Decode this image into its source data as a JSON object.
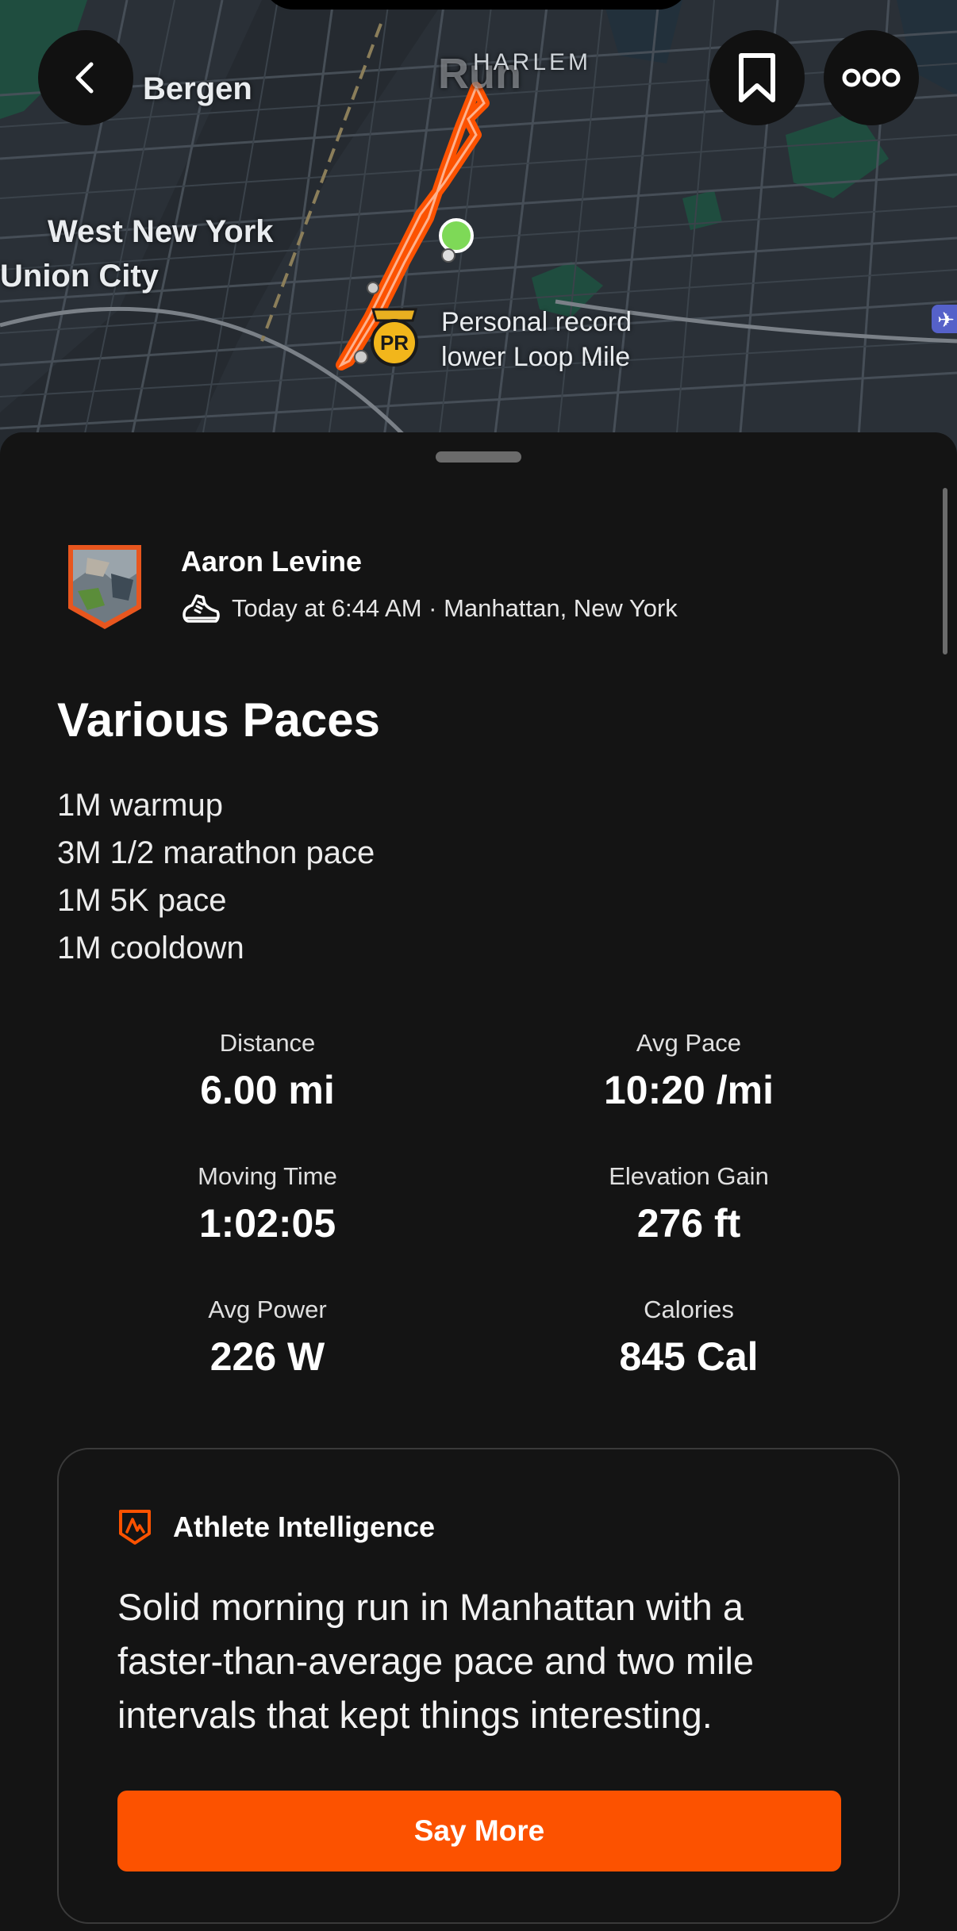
{
  "map": {
    "labels": {
      "bergen": "Bergen",
      "harlem": "HARLEM",
      "run_watermark": "Run",
      "west_new_york": "West New York",
      "union_city": "Union City",
      "pr_line1": "Personal record",
      "pr_line2": "lower Loop Mile",
      "pr_badge": "PR"
    },
    "route_color": "#fc5200",
    "start_marker_color": "#7ed957"
  },
  "nav": {
    "back_icon": "chevron-left-icon",
    "bookmark_icon": "bookmark-icon",
    "more_icon": "more-dots-icon"
  },
  "activity": {
    "athlete_name": "Aaron Levine",
    "meta": "Today at 6:44 AM · Manhattan, New York",
    "sport_icon": "running-shoe-icon",
    "title": "Various Paces",
    "description": [
      "1M warmup",
      "3M 1/2 marathon pace",
      "1M 5K pace",
      "1M cooldown"
    ]
  },
  "stats": [
    {
      "label": "Distance",
      "value": "6.00 mi"
    },
    {
      "label": "Avg Pace",
      "value": "10:20 /mi"
    },
    {
      "label": "Moving Time",
      "value": "1:02:05"
    },
    {
      "label": "Elevation Gain",
      "value": "276 ft"
    },
    {
      "label": "Avg Power",
      "value": "226 W"
    },
    {
      "label": "Calories",
      "value": "845 Cal"
    }
  ],
  "athlete_intelligence": {
    "title": "Athlete Intelligence",
    "summary": "Solid morning run in Manhattan with a faster-than-average pace and two mile intervals that kept things interesting.",
    "button_label": "Say More",
    "accent": "#fc5200"
  }
}
